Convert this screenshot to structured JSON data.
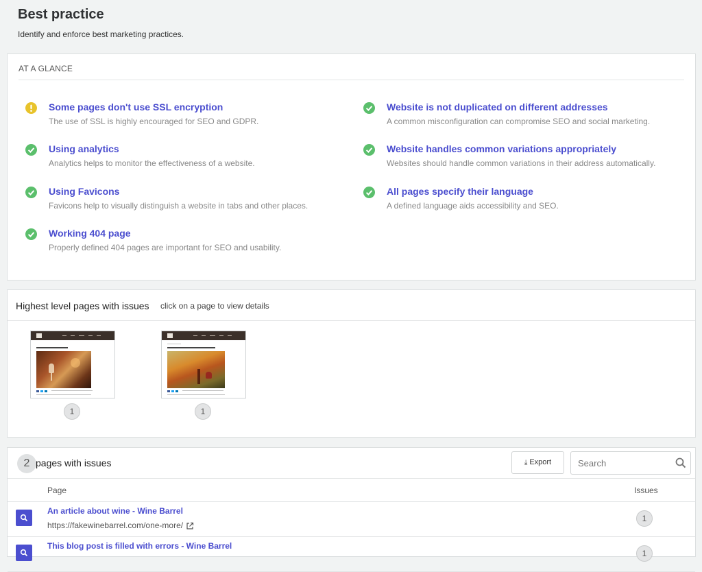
{
  "page": {
    "title": "Best practice",
    "subtitle": "Identify and enforce best marketing practices."
  },
  "glance": {
    "header": "AT A GLANCE",
    "checks": [
      {
        "status": "warning",
        "icon": "exclamation-icon",
        "title": "Some pages don't use SSL encryption",
        "description": "The use of SSL is highly encouraged for SEO and GDPR."
      },
      {
        "status": "ok",
        "icon": "checkmark-icon",
        "title": "Using analytics",
        "description": "Analytics helps to monitor the effectiveness of a website."
      },
      {
        "status": "ok",
        "icon": "checkmark-icon",
        "title": "Using Favicons",
        "description": "Favicons help to visually distinguish a website in tabs and other places."
      },
      {
        "status": "ok",
        "icon": "checkmark-icon",
        "title": "Working 404 page",
        "description": "Properly defined 404 pages are important for SEO and usability."
      },
      {
        "status": "ok",
        "icon": "checkmark-icon",
        "title": "Website is not duplicated on different addresses",
        "description": "A common misconfiguration can compromise SEO and social marketing."
      },
      {
        "status": "ok",
        "icon": "checkmark-icon",
        "title": "Website handles common variations appropriately",
        "description": "Websites should handle common variations in their address automatically."
      },
      {
        "status": "ok",
        "icon": "checkmark-icon",
        "title": "All pages specify their language",
        "description": "A defined language aids accessibility and SEO."
      }
    ]
  },
  "highest": {
    "header": "Highest level pages with issues",
    "subheader": "click on a page to view details",
    "pages": [
      {
        "thumbnail_heading": "AN ARTICLE ABOUT WINE",
        "issue_count": "1"
      },
      {
        "thumbnail_heading": "THIS BLOG POST IS FILLED WITH ERRORS",
        "issue_count": "1"
      }
    ]
  },
  "issues": {
    "count": "2",
    "label": "pages with issues",
    "export_label": "Export",
    "search_placeholder": "Search",
    "columns": {
      "page": "Page",
      "issues": "Issues"
    },
    "rows": [
      {
        "title": "An article about wine - Wine Barrel",
        "url": "https://fakewinebarrel.com/one-more/",
        "issues": "1"
      },
      {
        "title": "This blog post is filled with errors - Wine Barrel",
        "url": "",
        "issues": "1"
      }
    ]
  },
  "colors": {
    "accent": "#4b4ecf",
    "ok": "#5bbf6c",
    "warning": "#e8c32b"
  }
}
